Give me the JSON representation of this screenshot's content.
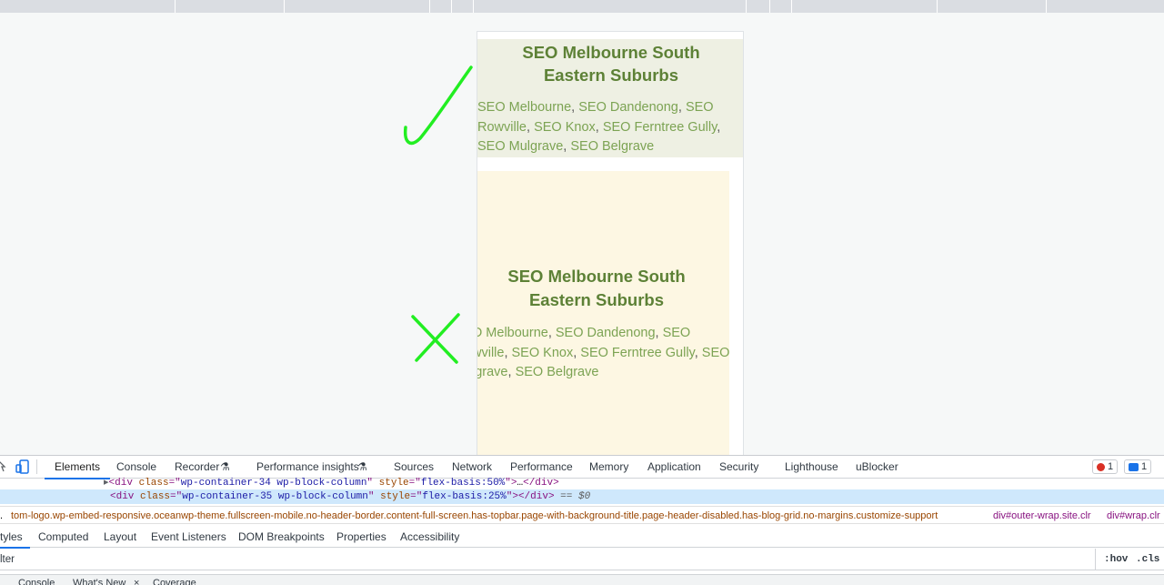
{
  "page": {
    "heading": "SEO Melbourne South Eastern Suburbs",
    "links": [
      "SEO Melbourne",
      "SEO Dandenong",
      "SEO Rowville",
      "SEO Knox",
      "SEO Ferntree Gully",
      "SEO Mulgrave",
      "SEO Belgrave"
    ],
    "separator": ",",
    "card2_links_visible": [
      "O Melbourne",
      "SEO Dandenong",
      "SEO",
      "wville",
      "SEO Knox",
      "SEO Ferntree Gully",
      "SEO",
      "lgrave",
      "SEO Belgrave"
    ]
  },
  "annotations": {
    "good": "check-mark",
    "bad": "x-mark",
    "color": "#22ee22"
  },
  "devtools": {
    "tabs": [
      "Elements",
      "Console",
      "Recorder",
      "Performance insights",
      "Sources",
      "Network",
      "Performance",
      "Memory",
      "Application",
      "Security",
      "Lighthouse",
      "uBlocker"
    ],
    "active_tab": "Elements",
    "error_count": "1",
    "message_count": "1",
    "dom": [
      {
        "tag": "div",
        "class": "wp-container-34 wp-block-column",
        "style": "flex-basis:50%",
        "content": "…"
      },
      {
        "tag": "div",
        "class": "wp-container-35 wp-block-column",
        "style": "flex-basis:25%",
        "content": "",
        "suffix": "== $0"
      }
    ],
    "breadcrumbs": [
      ".",
      "tom-logo.wp-embed-responsive.oceanwp-theme.fullscreen-mobile.no-header-border.content-full-screen.has-topbar.page-with-background-title.page-header-disabled.has-blog-grid.no-margins.customize-support",
      "div#outer-wrap.site.clr",
      "div#wrap.clr"
    ],
    "subtabs": [
      "tyles",
      "Computed",
      "Layout",
      "Event Listeners",
      "DOM Breakpoints",
      "Properties",
      "Accessibility"
    ],
    "filter_placeholder": "lter",
    "hov": ":hov",
    "cls": ".cls",
    "drawer_tabs": [
      "Console",
      "What's New",
      "Coverage"
    ]
  }
}
